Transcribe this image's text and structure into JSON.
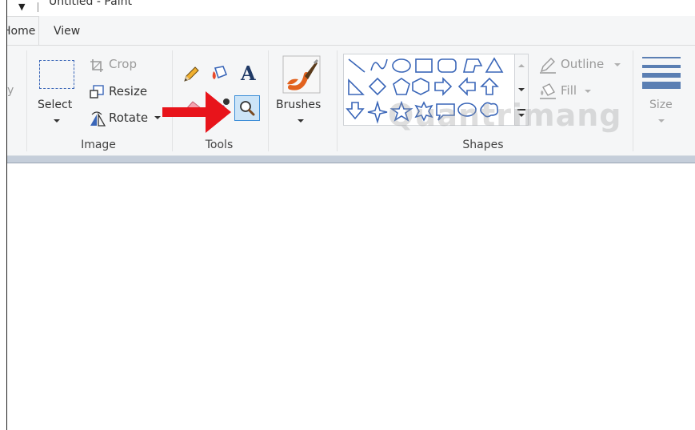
{
  "window": {
    "title": "Untitled - Paint"
  },
  "tabs": [
    {
      "label": "Home"
    },
    {
      "label": "View"
    }
  ],
  "ribbon": {
    "clipboard_partial_label": "y",
    "image": {
      "label": "Image",
      "select_label": "Select",
      "crop_label": "Crop",
      "resize_label": "Resize",
      "rotate_label": "Rotate"
    },
    "tools": {
      "label": "Tools"
    },
    "brushes": {
      "label": "Brushes"
    },
    "shapes": {
      "label": "Shapes",
      "outline_label": "Outline",
      "fill_label": "Fill"
    },
    "size": {
      "label": "Size"
    }
  },
  "watermark": "Quantrimang",
  "colors": {
    "highlight": "#cce4f7",
    "arrow": "#e8141b",
    "accent_blue": "#3a66b8"
  }
}
